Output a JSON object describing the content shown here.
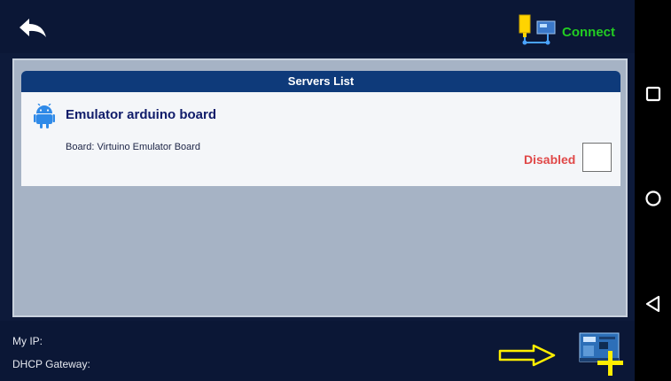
{
  "topbar": {
    "back_icon": "back-arrow-icon",
    "connect_label": "Connect",
    "connect_icon": "connection-icon"
  },
  "servers_list": {
    "title": "Servers List",
    "servers": [
      {
        "icon": "android-icon",
        "name": "Emulator arduino board",
        "board": "Board: Virtuino Emulator Board",
        "status": "Disabled",
        "enabled": false
      }
    ]
  },
  "bottombar": {
    "my_ip_label": "My IP:",
    "dhcp_label": "DHCP Gateway:",
    "arrow_icon": "arrow-right-icon",
    "add_board_icon": "add-board-icon"
  },
  "navbar": {
    "recents_icon": "recents-square-icon",
    "home_icon": "home-circle-icon",
    "back_icon": "back-triangle-icon"
  },
  "colors": {
    "bar_bg": "#0b1736",
    "panel_bg": "#a6b3c5",
    "header_bg": "#0e3a7a",
    "connect": "#22cc22",
    "disabled": "#e04848",
    "arrow": "#ffee00"
  }
}
